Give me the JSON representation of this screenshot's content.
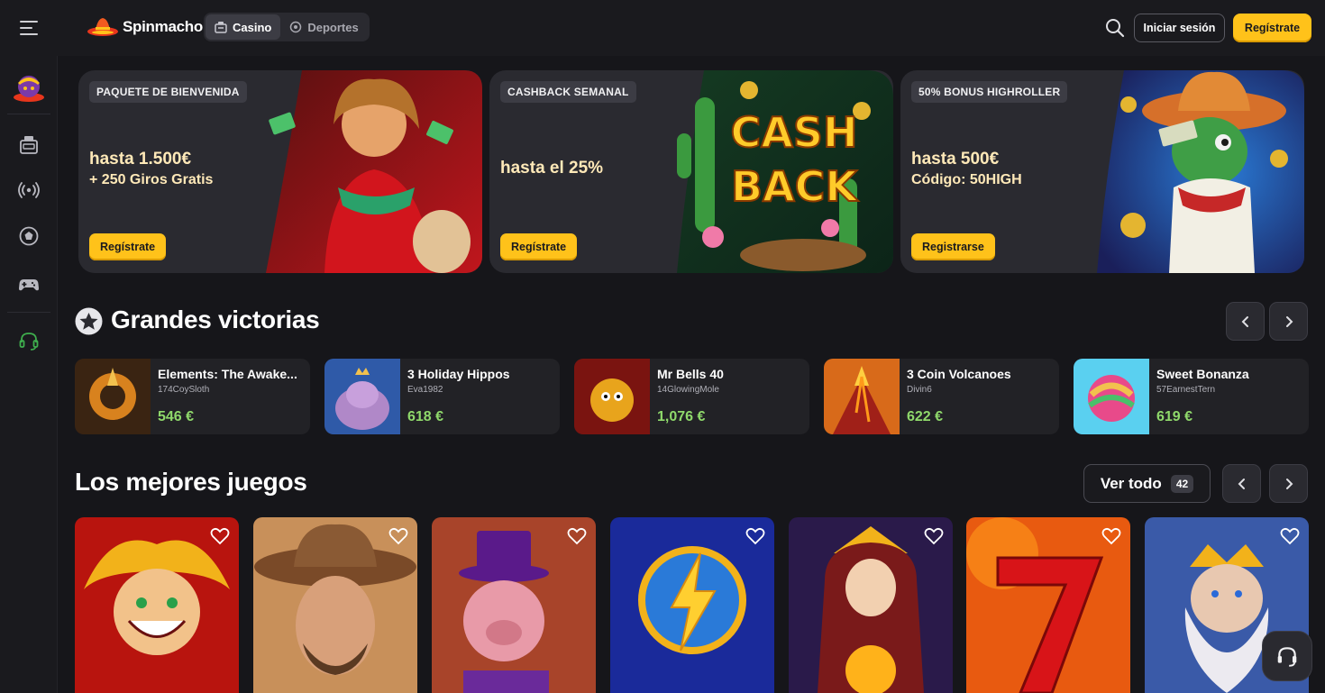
{
  "header": {
    "logo_text": "Spinmacho",
    "tabs": [
      {
        "label": "Casino",
        "active": true
      },
      {
        "label": "Deportes",
        "active": false
      }
    ],
    "login_label": "Iniciar sesión",
    "register_label": "Regístrate"
  },
  "colors": {
    "accent": "#ffc21a",
    "background": "#16161a",
    "panel": "#222226",
    "win_amount": "#8fd96b"
  },
  "sidebar": {
    "items": [
      {
        "icon": "profile-avatar-icon"
      },
      {
        "icon": "slot-machine-icon"
      },
      {
        "icon": "live-broadcast-icon"
      },
      {
        "icon": "football-icon"
      },
      {
        "icon": "gamepad-icon"
      },
      {
        "icon": "support-headset-icon"
      }
    ]
  },
  "banners": [
    {
      "tag": "PAQUETE DE BIENVENIDA",
      "line1": "hasta 1.500€",
      "line2": "+ 250 Giros Gratis",
      "button": "Regístrate"
    },
    {
      "tag": "CASHBACK SEMANAL",
      "line1": "hasta el 25%",
      "line2": "",
      "button": "Regístrate",
      "art_text_1": "CASH",
      "art_text_2": "BACK"
    },
    {
      "tag": "50% BONUS HIGHROLLER",
      "line1": "hasta 500€",
      "line2": "Código: 50HIGH",
      "button": "Registrarse"
    }
  ],
  "big_wins": {
    "title": "Grandes victorias",
    "items": [
      {
        "game": "Elements: The Awake...",
        "user": "174CoySloth",
        "amount": "546 €"
      },
      {
        "game": "3 Holiday Hippos",
        "user": "Eva1982",
        "amount": "618 €"
      },
      {
        "game": "Mr Bells 40",
        "user": "14GlowingMole",
        "amount": "1,076 €"
      },
      {
        "game": "3 Coin Volcanoes",
        "user": "Divin6",
        "amount": "622 €"
      },
      {
        "game": "Sweet Bonanza",
        "user": "57EarnestTern",
        "amount": "619 €"
      }
    ]
  },
  "top_games": {
    "title": "Los mejores juegos",
    "view_all_label": "Ver todo",
    "view_all_count": "42",
    "items": [
      {
        "name": "joker-game"
      },
      {
        "name": "cowboy-game"
      },
      {
        "name": "pig-game"
      },
      {
        "name": "lightning-game"
      },
      {
        "name": "goddess-game"
      },
      {
        "name": "seven-game"
      },
      {
        "name": "zeus-game"
      }
    ]
  }
}
